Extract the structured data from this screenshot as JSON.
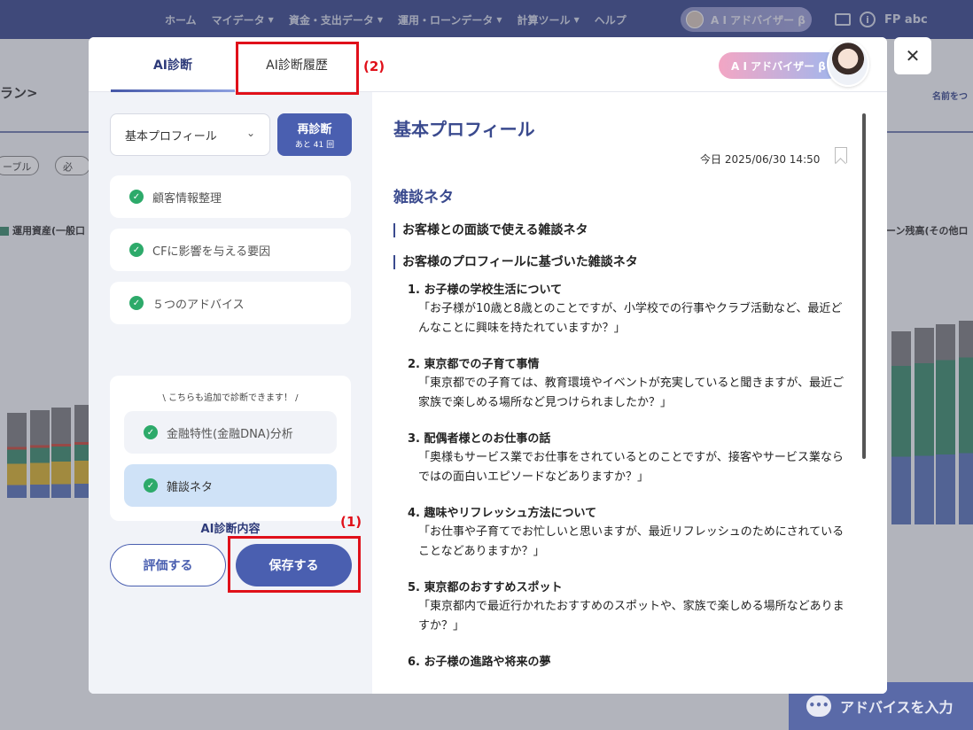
{
  "nav": {
    "items": [
      {
        "label": "ホーム",
        "caret": false
      },
      {
        "label": "マイデータ",
        "caret": true
      },
      {
        "label": "資金・支出データ",
        "caret": true
      },
      {
        "label": "運用・ローンデータ",
        "caret": true
      },
      {
        "label": "計算ツール",
        "caret": true
      },
      {
        "label": "ヘルプ",
        "caret": false
      }
    ],
    "ai_pill_label": "A I アドバイザー β",
    "user_label": "FP abc"
  },
  "background": {
    "page_title": "ラン>",
    "chip_1": "ーブル",
    "chip_2": "必",
    "legend_left": "運用資産(一般口",
    "legend_right": "ーン残高(その他ロ",
    "link_right": "名前をつ"
  },
  "modal": {
    "tabs": {
      "diagnosis": "AI診断",
      "history": "AI診断履歴"
    },
    "ai_badge": "A I アドバイザー β",
    "left": {
      "select_value": "基本プロフィール",
      "rediagnose_label": "再診断",
      "rediagnose_remaining": "あと 41 回",
      "steps": [
        "顧客情報整理",
        "CFに影響を与える要因",
        "５つのアドバイス"
      ],
      "extra_note": "\\ こちらも追加で診断できます！ /",
      "extra_items": [
        "金融特性(金融DNA)分析",
        "雑談ネタ"
      ],
      "content_label": "AI診断内容",
      "evaluate_button": "評価する",
      "save_button": "保存する"
    },
    "right": {
      "title": "基本プロフィール",
      "date": "今日 2025/06/30 14:50",
      "section_title": "雑談ネタ",
      "sub1": "お客様との面談で使える雑談ネタ",
      "sub2": "お客様のプロフィールに基づいた雑談ネタ",
      "topics": [
        {
          "title": "1. お子様の学校生活について",
          "body": "「お子様が10歳と8歳とのことですが、小学校での行事やクラブ活動など、最近どんなことに興味を持たれていますか？」"
        },
        {
          "title": "2. 東京都での子育て事情",
          "body": "「東京都での子育ては、教育環境やイベントが充実していると聞きますが、最近ご家族で楽しめる場所など見つけられましたか？」"
        },
        {
          "title": "3. 配偶者様とのお仕事の話",
          "body": "「奥様もサービス業でお仕事をされているとのことですが、接客やサービス業ならではの面白いエピソードなどありますか？」"
        },
        {
          "title": "4. 趣味やリフレッシュ方法について",
          "body": "「お仕事や子育てでお忙しいと思いますが、最近リフレッシュのためにされていることなどありますか？」"
        },
        {
          "title": "5. 東京都のおすすめスポット",
          "body": "「東京都内で最近行かれたおすすめのスポットや、家族で楽しめる場所などありますか？」"
        },
        {
          "title": "6. お子様の進路や将来の夢",
          "body": ""
        }
      ]
    }
  },
  "annotations": {
    "label_1": "(1)",
    "label_2": "(2)"
  },
  "fab_label": "アドバイスを入力",
  "colors": {
    "nav_bg": "#3a4a8e",
    "accent": "#4a5fb0",
    "check": "#2daa6a",
    "highlight": "#e0101a"
  }
}
